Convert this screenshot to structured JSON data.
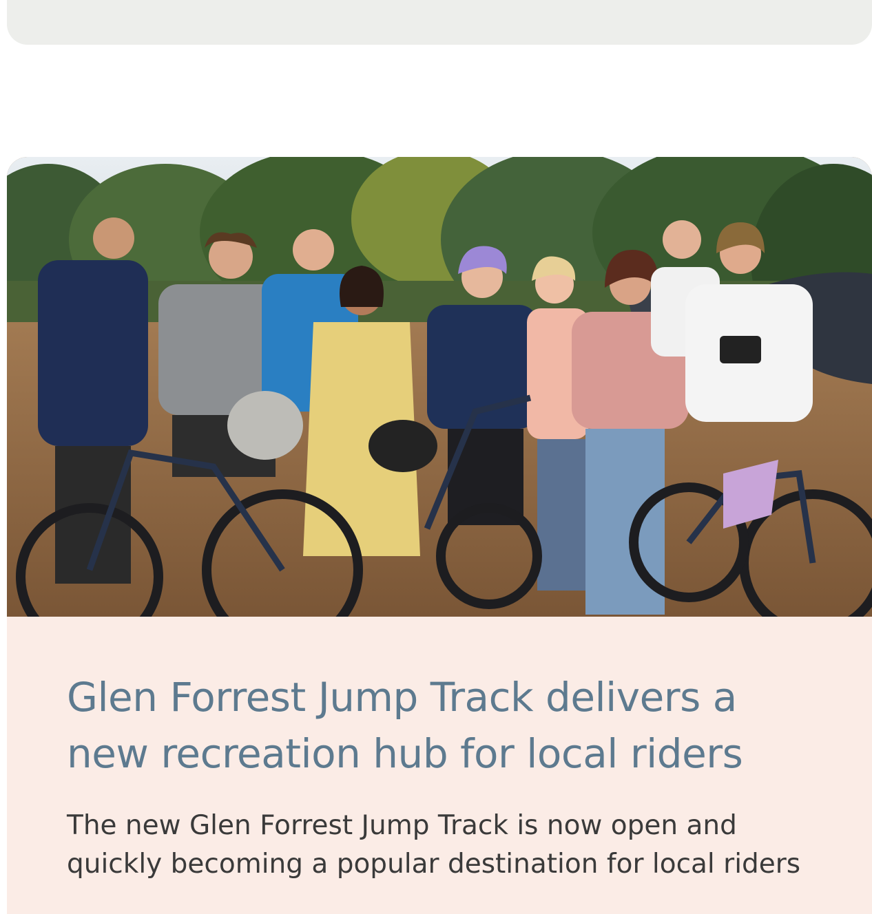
{
  "article": {
    "title": "Glen Forrest Jump Track delivers a new recreation hub for local riders",
    "excerpt": "The new Glen Forrest Jump Track is now open and quickly becoming a popular destination for local riders",
    "image_subject": "group-of-riders-with-bikes-photo"
  },
  "colors": {
    "top_card_bg": "#edeeeb",
    "card_body_bg": "#fbece6",
    "headline": "#5d7a8f",
    "body_text": "#3a3a3a"
  }
}
